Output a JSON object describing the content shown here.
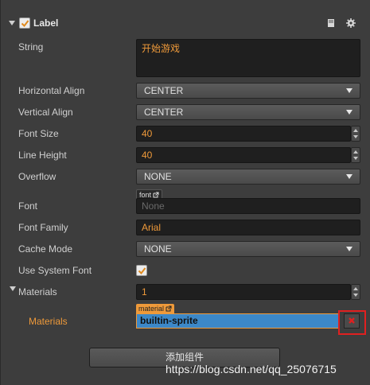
{
  "header": {
    "title": "Label",
    "enabled": true,
    "icons": [
      "book-icon",
      "gear-icon"
    ]
  },
  "properties": {
    "string": {
      "label": "String",
      "value": "开始游戏"
    },
    "horizontal_align": {
      "label": "Horizontal Align",
      "value": "CENTER"
    },
    "vertical_align": {
      "label": "Vertical Align",
      "value": "CENTER"
    },
    "font_size": {
      "label": "Font Size",
      "value": "40"
    },
    "line_height": {
      "label": "Line Height",
      "value": "40"
    },
    "overflow": {
      "label": "Overflow",
      "value": "NONE"
    },
    "font": {
      "label": "Font",
      "tag": "font",
      "value": "None"
    },
    "font_family": {
      "label": "Font Family",
      "value": "Arial"
    },
    "cache_mode": {
      "label": "Cache Mode",
      "value": "NONE"
    },
    "use_system_font": {
      "label": "Use System Font",
      "checked": true
    },
    "materials_count": {
      "label": "Materials",
      "value": "1"
    },
    "materials_item": {
      "label": "Materials",
      "tag": "material",
      "value": "builtin-sprite"
    }
  },
  "add_component_label": "添加组件",
  "watermark": "https://blog.csdn.net/qq_25076715",
  "colors": {
    "accent": "#ef9a3a",
    "selected": "#3c88c8",
    "highlight_frame": "#e02020"
  }
}
